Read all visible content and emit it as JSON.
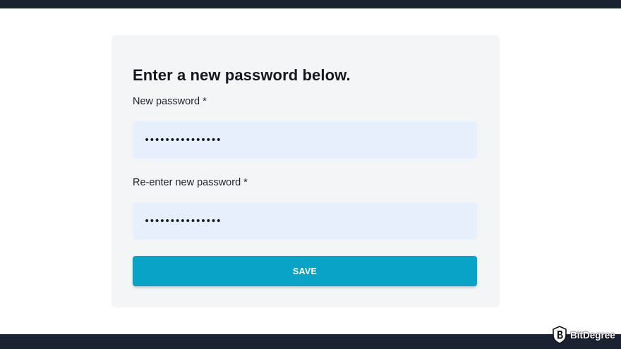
{
  "form": {
    "heading": "Enter a new password below.",
    "new_password_label": "New password *",
    "new_password_value": "•••••••••••••••",
    "reenter_password_label": "Re-enter new password *",
    "reenter_password_value": "•••••••••••••••",
    "save_label": "SAVE"
  },
  "watermark": {
    "brand": "BitDegree"
  },
  "colors": {
    "header_bar": "#1b2232",
    "card_background": "#f4f5f6",
    "input_background": "#e8effc",
    "save_button": "#0aa3c8"
  }
}
